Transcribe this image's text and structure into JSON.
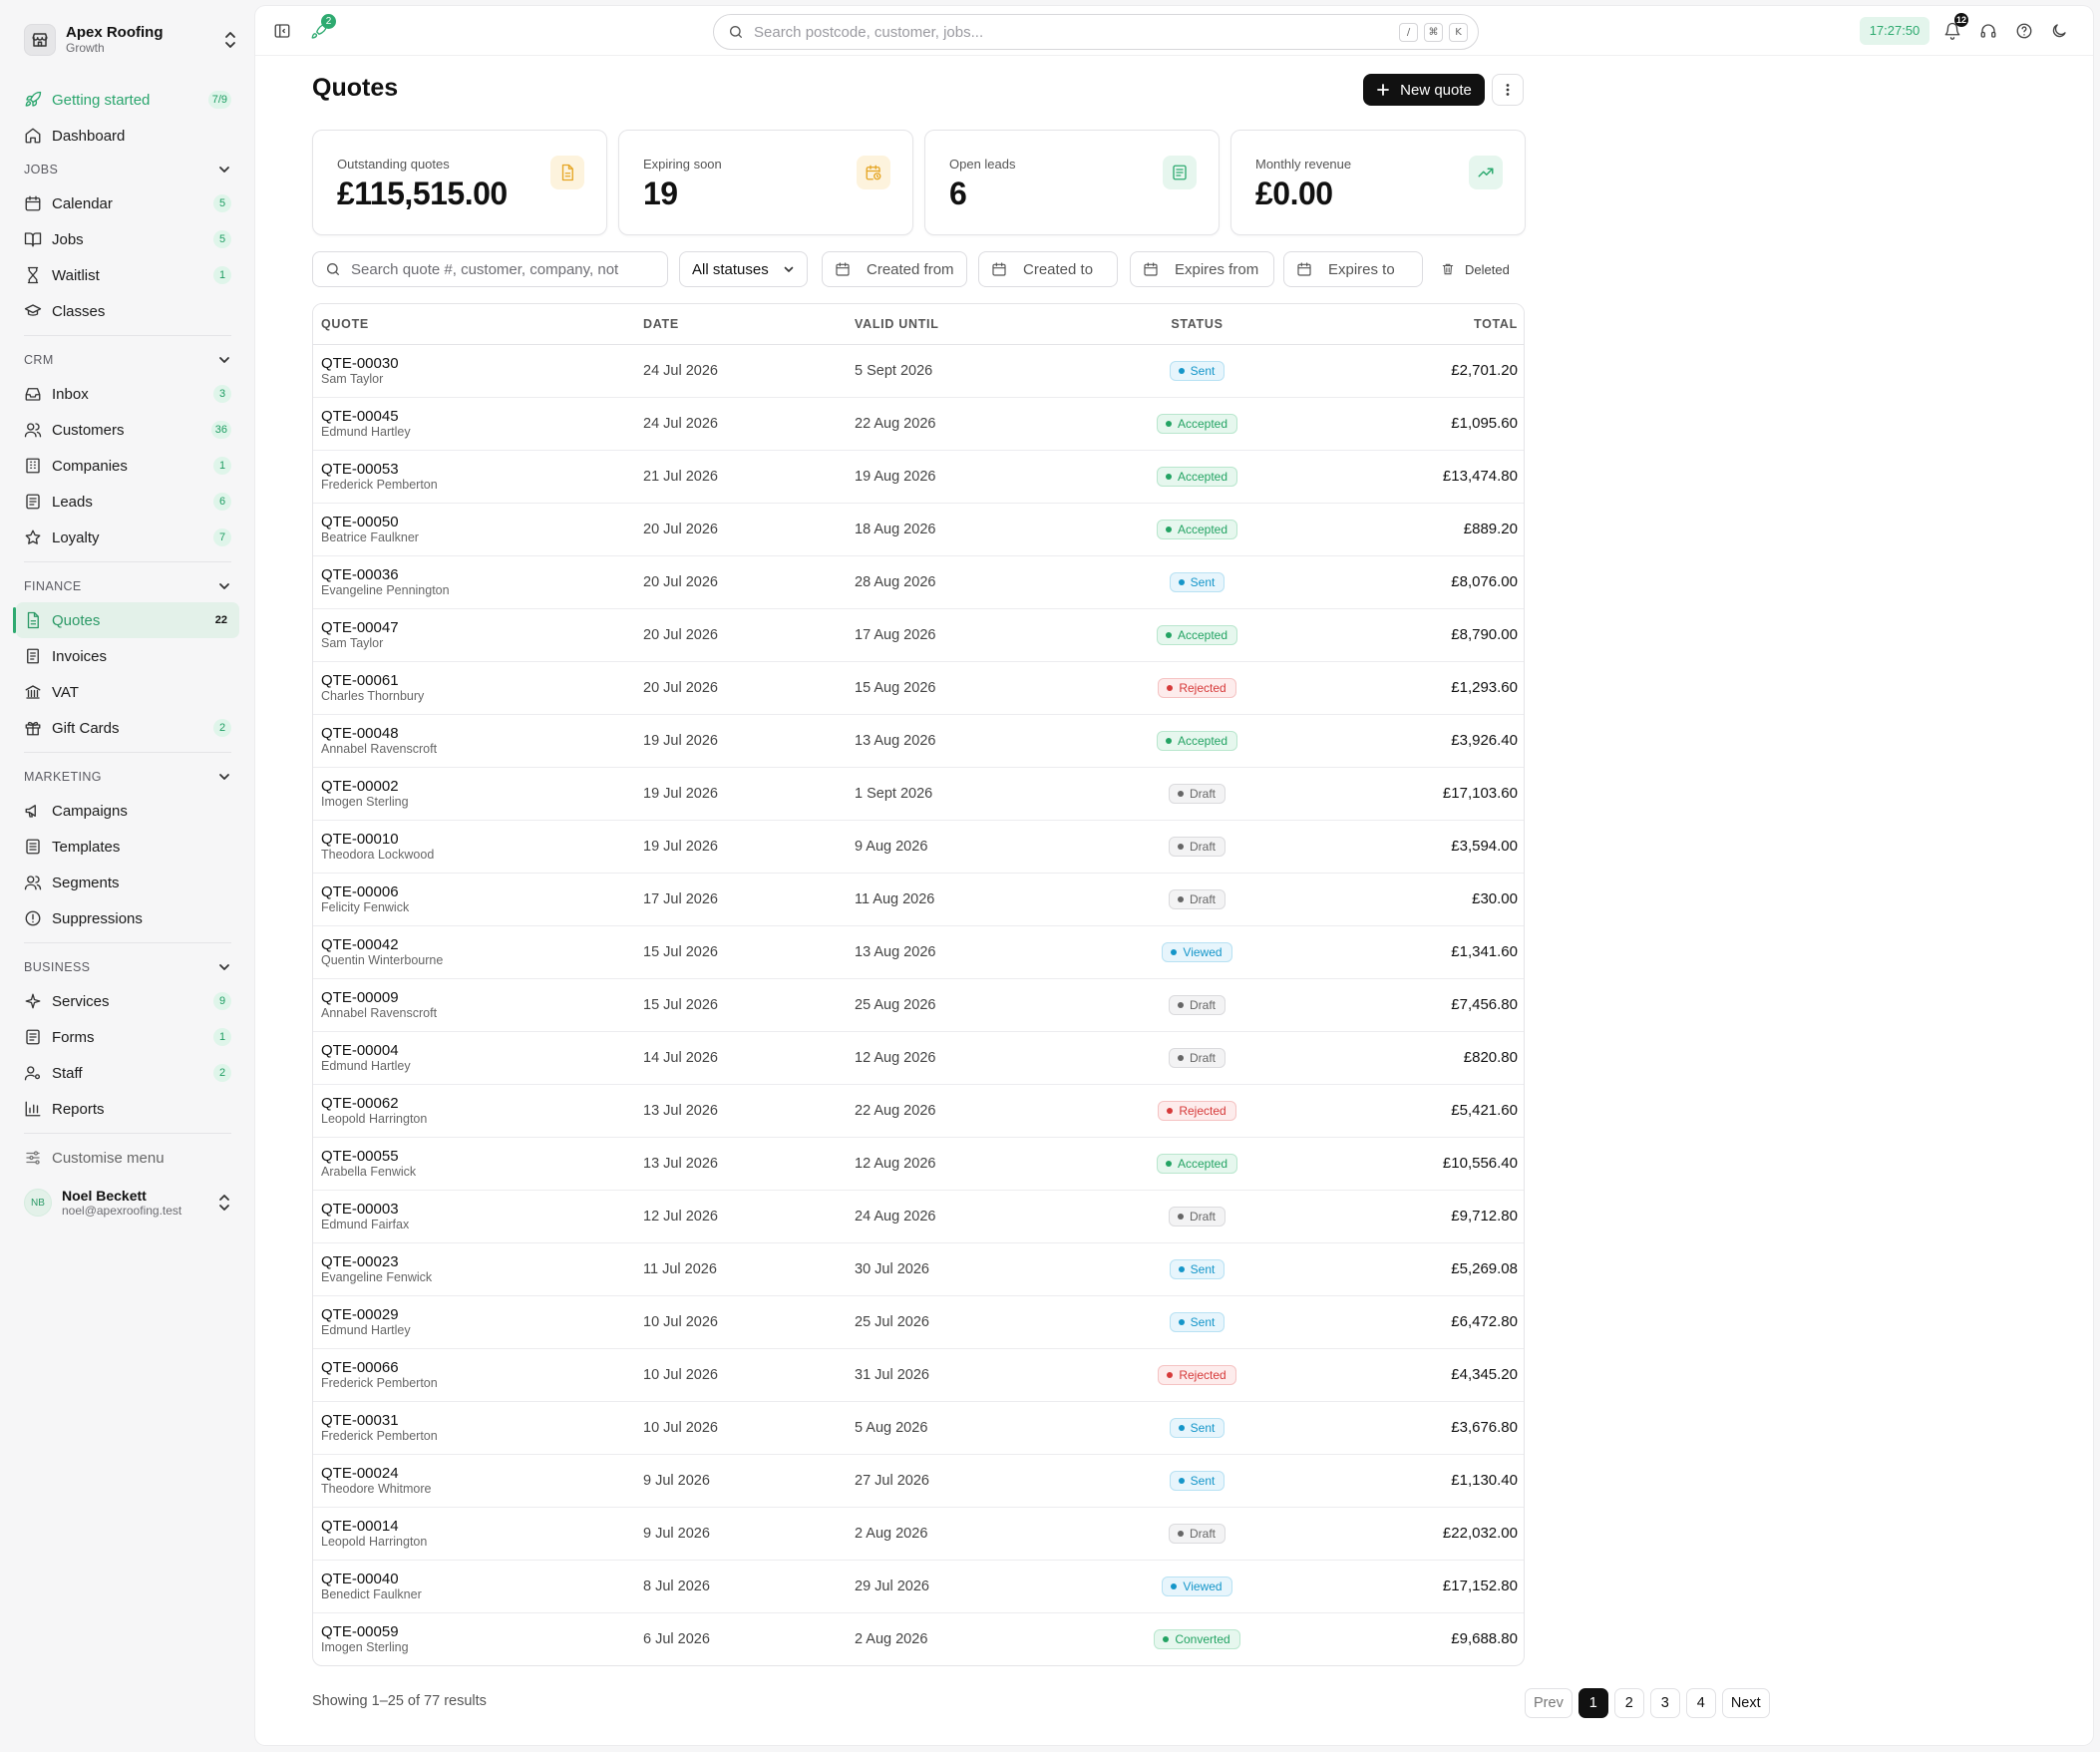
{
  "brand": {
    "name": "Apex Roofing",
    "plan": "Growth"
  },
  "nav": {
    "getting_started": {
      "label": "Getting started",
      "badge": "7/9"
    },
    "dashboard": {
      "label": "Dashboard"
    },
    "jobs_section": "JOBS",
    "jobs": [
      {
        "label": "Calendar",
        "badge": "5"
      },
      {
        "label": "Jobs",
        "badge": "5"
      },
      {
        "label": "Waitlist",
        "badge": "1"
      },
      {
        "label": "Classes",
        "badge": ""
      }
    ],
    "crm_section": "CRM",
    "crm": [
      {
        "label": "Inbox",
        "badge": "3"
      },
      {
        "label": "Customers",
        "badge": "36"
      },
      {
        "label": "Companies",
        "badge": "1"
      },
      {
        "label": "Leads",
        "badge": "6"
      },
      {
        "label": "Loyalty",
        "badge": "7"
      }
    ],
    "finance_section": "FINANCE",
    "finance": [
      {
        "label": "Quotes",
        "badge": "22"
      },
      {
        "label": "Invoices",
        "badge": ""
      },
      {
        "label": "VAT",
        "badge": ""
      },
      {
        "label": "Gift Cards",
        "badge": "2"
      }
    ],
    "marketing_section": "MARKETING",
    "marketing": [
      {
        "label": "Campaigns",
        "badge": ""
      },
      {
        "label": "Templates",
        "badge": ""
      },
      {
        "label": "Segments",
        "badge": ""
      },
      {
        "label": "Suppressions",
        "badge": ""
      }
    ],
    "business_section": "BUSINESS",
    "business": [
      {
        "label": "Services",
        "badge": "9"
      },
      {
        "label": "Forms",
        "badge": "1"
      },
      {
        "label": "Staff",
        "badge": "2"
      },
      {
        "label": "Reports",
        "badge": ""
      }
    ],
    "customise": "Customise menu"
  },
  "user": {
    "initials": "NB",
    "name": "Noel Beckett",
    "email": "noel@apexroofing.test"
  },
  "topbar": {
    "rocket_badge": "2",
    "search_placeholder": "Search postcode, customer, jobs...",
    "kbd": [
      "/",
      "⌘",
      "K"
    ],
    "clock": "17:27:50",
    "notif_badge": "12"
  },
  "page": {
    "title": "Quotes",
    "new_button": "New quote"
  },
  "stats": [
    {
      "label": "Outstanding quotes",
      "value": "£115,515.00",
      "icon": "document-icon",
      "color": "#e5a523",
      "bg": "#fdf3dd"
    },
    {
      "label": "Expiring soon",
      "value": "19",
      "icon": "calendar-clock-icon",
      "color": "#e5a523",
      "bg": "#fdf3dd"
    },
    {
      "label": "Open leads",
      "value": "6",
      "icon": "clipboard-icon",
      "color": "#2eaa70",
      "bg": "#e6f6ee"
    },
    {
      "label": "Monthly revenue",
      "value": "£0.00",
      "icon": "trend-up-icon",
      "color": "#2eaa70",
      "bg": "#e6f6ee"
    }
  ],
  "filters": {
    "search_placeholder": "Search quote #, customer, company, not",
    "status": "All statuses",
    "created_from": "Created from",
    "created_to": "Created to",
    "expires_from": "Expires from",
    "expires_to": "Expires to",
    "deleted": "Deleted"
  },
  "table": {
    "columns": [
      "QUOTE",
      "DATE",
      "VALID UNTIL",
      "STATUS",
      "TOTAL"
    ],
    "rows": [
      {
        "quote": "QTE-00030",
        "customer": "Sam Taylor",
        "date": "24 Jul 2026",
        "valid": "5 Sept 2026",
        "status": "Sent",
        "total": "£2,701.20"
      },
      {
        "quote": "QTE-00045",
        "customer": "Edmund Hartley",
        "date": "24 Jul 2026",
        "valid": "22 Aug 2026",
        "status": "Accepted",
        "total": "£1,095.60"
      },
      {
        "quote": "QTE-00053",
        "customer": "Frederick Pemberton",
        "date": "21 Jul 2026",
        "valid": "19 Aug 2026",
        "status": "Accepted",
        "total": "£13,474.80"
      },
      {
        "quote": "QTE-00050",
        "customer": "Beatrice Faulkner",
        "date": "20 Jul 2026",
        "valid": "18 Aug 2026",
        "status": "Accepted",
        "total": "£889.20"
      },
      {
        "quote": "QTE-00036",
        "customer": "Evangeline Pennington",
        "date": "20 Jul 2026",
        "valid": "28 Aug 2026",
        "status": "Sent",
        "total": "£8,076.00"
      },
      {
        "quote": "QTE-00047",
        "customer": "Sam Taylor",
        "date": "20 Jul 2026",
        "valid": "17 Aug 2026",
        "status": "Accepted",
        "total": "£8,790.00"
      },
      {
        "quote": "QTE-00061",
        "customer": "Charles Thornbury",
        "date": "20 Jul 2026",
        "valid": "15 Aug 2026",
        "status": "Rejected",
        "total": "£1,293.60"
      },
      {
        "quote": "QTE-00048",
        "customer": "Annabel Ravenscroft",
        "date": "19 Jul 2026",
        "valid": "13 Aug 2026",
        "status": "Accepted",
        "total": "£3,926.40"
      },
      {
        "quote": "QTE-00002",
        "customer": "Imogen Sterling",
        "date": "19 Jul 2026",
        "valid": "1 Sept 2026",
        "status": "Draft",
        "total": "£17,103.60"
      },
      {
        "quote": "QTE-00010",
        "customer": "Theodora Lockwood",
        "date": "19 Jul 2026",
        "valid": "9 Aug 2026",
        "status": "Draft",
        "total": "£3,594.00"
      },
      {
        "quote": "QTE-00006",
        "customer": "Felicity Fenwick",
        "date": "17 Jul 2026",
        "valid": "11 Aug 2026",
        "status": "Draft",
        "total": "£30.00"
      },
      {
        "quote": "QTE-00042",
        "customer": "Quentin Winterbourne",
        "date": "15 Jul 2026",
        "valid": "13 Aug 2026",
        "status": "Viewed",
        "total": "£1,341.60"
      },
      {
        "quote": "QTE-00009",
        "customer": "Annabel Ravenscroft",
        "date": "15 Jul 2026",
        "valid": "25 Aug 2026",
        "status": "Draft",
        "total": "£7,456.80"
      },
      {
        "quote": "QTE-00004",
        "customer": "Edmund Hartley",
        "date": "14 Jul 2026",
        "valid": "12 Aug 2026",
        "status": "Draft",
        "total": "£820.80"
      },
      {
        "quote": "QTE-00062",
        "customer": "Leopold Harrington",
        "date": "13 Jul 2026",
        "valid": "22 Aug 2026",
        "status": "Rejected",
        "total": "£5,421.60"
      },
      {
        "quote": "QTE-00055",
        "customer": "Arabella Fenwick",
        "date": "13 Jul 2026",
        "valid": "12 Aug 2026",
        "status": "Accepted",
        "total": "£10,556.40"
      },
      {
        "quote": "QTE-00003",
        "customer": "Edmund Fairfax",
        "date": "12 Jul 2026",
        "valid": "24 Aug 2026",
        "status": "Draft",
        "total": "£9,712.80"
      },
      {
        "quote": "QTE-00023",
        "customer": "Evangeline Fenwick",
        "date": "11 Jul 2026",
        "valid": "30 Jul 2026",
        "status": "Sent",
        "total": "£5,269.08"
      },
      {
        "quote": "QTE-00029",
        "customer": "Edmund Hartley",
        "date": "10 Jul 2026",
        "valid": "25 Jul 2026",
        "status": "Sent",
        "total": "£6,472.80"
      },
      {
        "quote": "QTE-00066",
        "customer": "Frederick Pemberton",
        "date": "10 Jul 2026",
        "valid": "31 Jul 2026",
        "status": "Rejected",
        "total": "£4,345.20"
      },
      {
        "quote": "QTE-00031",
        "customer": "Frederick Pemberton",
        "date": "10 Jul 2026",
        "valid": "5 Aug 2026",
        "status": "Sent",
        "total": "£3,676.80"
      },
      {
        "quote": "QTE-00024",
        "customer": "Theodore Whitmore",
        "date": "9 Jul 2026",
        "valid": "27 Jul 2026",
        "status": "Sent",
        "total": "£1,130.40"
      },
      {
        "quote": "QTE-00014",
        "customer": "Leopold Harrington",
        "date": "9 Jul 2026",
        "valid": "2 Aug 2026",
        "status": "Draft",
        "total": "£22,032.00"
      },
      {
        "quote": "QTE-00040",
        "customer": "Benedict Faulkner",
        "date": "8 Jul 2026",
        "valid": "29 Jul 2026",
        "status": "Viewed",
        "total": "£17,152.80"
      },
      {
        "quote": "QTE-00059",
        "customer": "Imogen Sterling",
        "date": "6 Jul 2026",
        "valid": "2 Aug 2026",
        "status": "Converted",
        "total": "£9,688.80"
      }
    ]
  },
  "status_colors": {
    "Sent": {
      "fg": "#1596c9",
      "bg": "#e7f5fc",
      "border": "#b7e1f3"
    },
    "Viewed": {
      "fg": "#1596c9",
      "bg": "#e7f5fc",
      "border": "#b7e1f3"
    },
    "Accepted": {
      "fg": "#23a363",
      "bg": "#e6f7ee",
      "border": "#b8e6cd"
    },
    "Converted": {
      "fg": "#23a363",
      "bg": "#e6f7ee",
      "border": "#b8e6cd"
    },
    "Rejected": {
      "fg": "#d63a3a",
      "bg": "#fdecec",
      "border": "#f5c2c2"
    },
    "Draft": {
      "fg": "#666666",
      "bg": "#f3f3f4",
      "border": "#dadadd"
    }
  },
  "footer": {
    "showing": "Showing 1–25 of 77 results",
    "prev": "Prev",
    "pages": [
      "1",
      "2",
      "3",
      "4"
    ],
    "current_page": "1",
    "next": "Next"
  }
}
